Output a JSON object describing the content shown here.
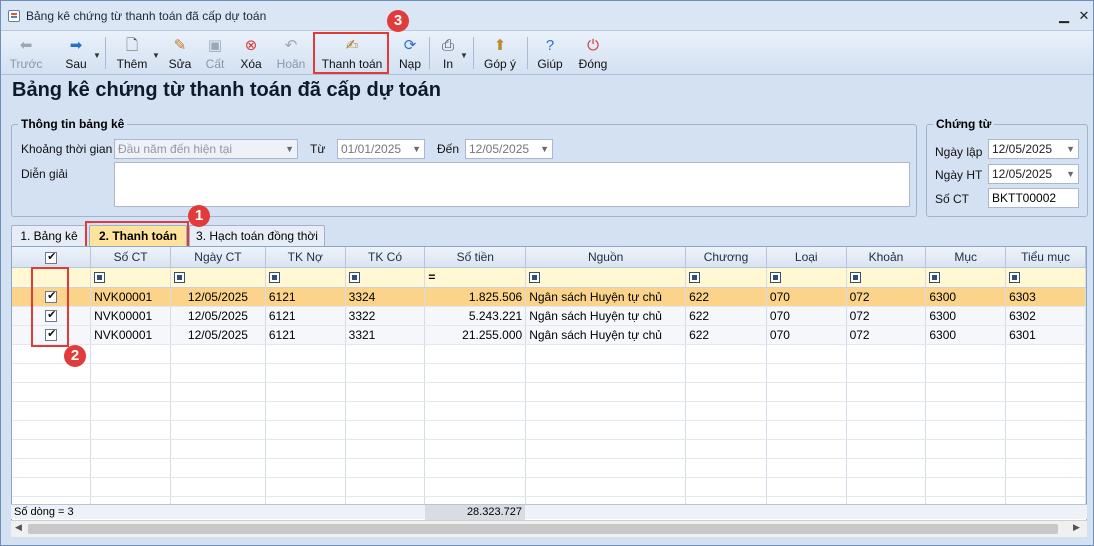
{
  "window": {
    "title": "Bảng kê chứng từ thanh toán đã cấp dự toán"
  },
  "toolbar": {
    "back": "Trước",
    "next": "Sau",
    "add": "Thêm",
    "edit": "Sửa",
    "save": "Cất",
    "delete": "Xóa",
    "undo": "Hoãn",
    "pay": "Thanh toán",
    "reload": "Nạp",
    "print": "In",
    "feedback": "Góp ý",
    "help": "Giúp",
    "close": "Đóng"
  },
  "page_title": "Bảng kê chứng từ thanh toán đã cấp dự toán",
  "info": {
    "legend": "Thông tin bảng kê",
    "period_label": "Khoảng thời gian",
    "period_value": "Đầu năm đến hiện tại",
    "from_label": "Từ",
    "from_value": "01/01/2025",
    "to_label": "Đến",
    "to_value": "12/05/2025",
    "desc_label": "Diễn giải",
    "desc_value": ""
  },
  "voucher": {
    "legend": "Chứng từ",
    "created_label": "Ngày lập",
    "created_value": "12/05/2025",
    "posted_label": "Ngày HT",
    "posted_value": "12/05/2025",
    "number_label": "Số CT",
    "number_value": "BKTT00002"
  },
  "tabs": [
    {
      "label": "1. Bảng kê"
    },
    {
      "label": "2. Thanh toán"
    },
    {
      "label": "3. Hạch toán đồng thời"
    }
  ],
  "grid": {
    "columns": [
      "Số CT",
      "Ngày CT",
      "TK Nợ",
      "TK Có",
      "Số tiền",
      "Nguồn",
      "Chương",
      "Loại",
      "Khoản",
      "Mục",
      "Tiểu mục"
    ],
    "rows": [
      {
        "so_ct": "NVK00001",
        "ngay_ct": "12/05/2025",
        "tk_no": "6121",
        "tk_co": "3324",
        "so_tien": "1.825.506",
        "nguon": "Ngân sách Huyện tự chủ",
        "chuong": "622",
        "loai": "070",
        "khoan": "072",
        "muc": "6300",
        "tieu_muc": "6303"
      },
      {
        "so_ct": "NVK00001",
        "ngay_ct": "12/05/2025",
        "tk_no": "6121",
        "tk_co": "3322",
        "so_tien": "5.243.221",
        "nguon": "Ngân sách Huyện tự chủ",
        "chuong": "622",
        "loai": "070",
        "khoan": "072",
        "muc": "6300",
        "tieu_muc": "6302"
      },
      {
        "so_ct": "NVK00001",
        "ngay_ct": "12/05/2025",
        "tk_no": "6121",
        "tk_co": "3321",
        "so_tien": "21.255.000",
        "nguon": "Ngân sách Huyện tự chủ",
        "chuong": "622",
        "loai": "070",
        "khoan": "072",
        "muc": "6300",
        "tieu_muc": "6301"
      }
    ],
    "footer_count": "Số dòng = 3",
    "footer_total": "28.323.727"
  },
  "callouts": {
    "one": "1",
    "two": "2",
    "three": "3"
  },
  "colors": {
    "highlight": "#e03a3a",
    "selected_row": "#fbd38a",
    "active_tab": "#fde39b"
  }
}
